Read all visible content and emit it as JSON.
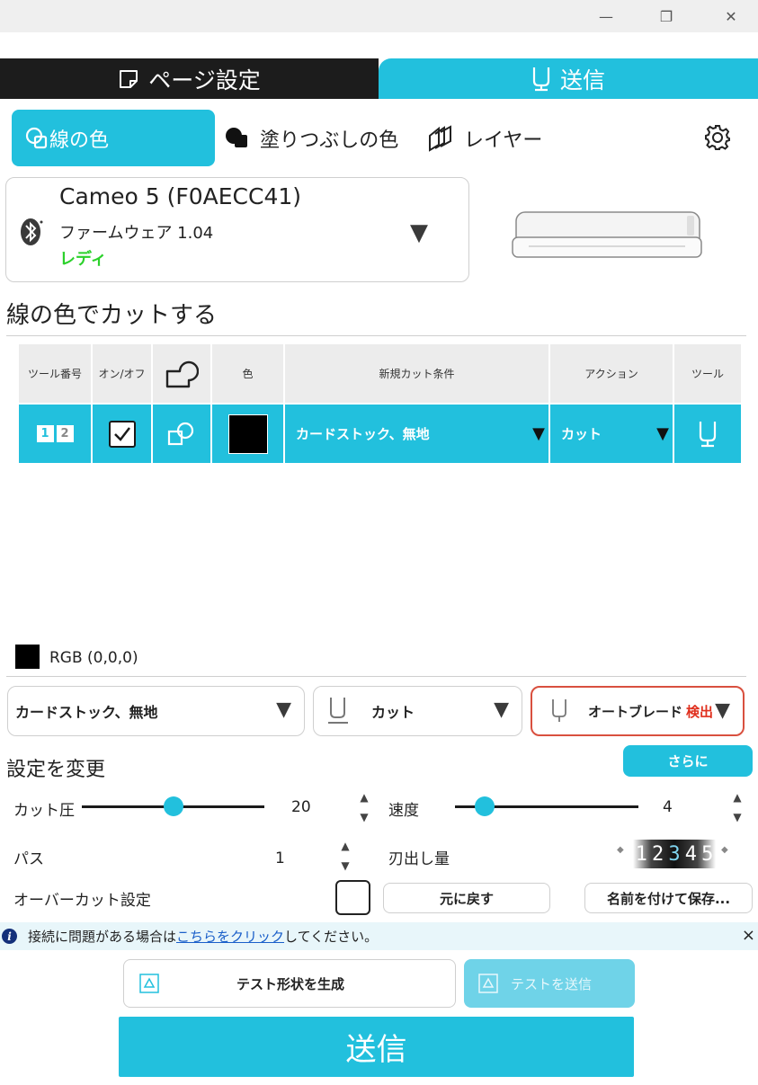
{
  "window": {
    "minimize_glyph": "—",
    "restore_glyph": "❐",
    "close_glyph": "✕"
  },
  "main_tabs": [
    {
      "label": "ページ設定",
      "icon": "page-icon",
      "active": false
    },
    {
      "label": "送信",
      "icon": "blade-holder-icon",
      "active": true
    }
  ],
  "sub_tabs": [
    {
      "label": "線の色",
      "icon": "line-color-icon",
      "active": true
    },
    {
      "label": "塗りつぶしの色",
      "icon": "fill-color-icon",
      "active": false
    },
    {
      "label": "レイヤー",
      "icon": "layer-icon",
      "active": false
    }
  ],
  "settings_icon": "gear-icon",
  "device": {
    "name": "Cameo 5 (F0AECC41)",
    "firmware": "ファームウェア 1.04",
    "status": "レディ",
    "status_color": "#2bd12b",
    "connection_icon": "bluetooth-icon"
  },
  "section_title": "線の色でカットする",
  "table": {
    "headers": [
      "ツール番号",
      "オン/オフ",
      "",
      "色",
      "新規カット条件",
      "アクション",
      "ツール"
    ],
    "rows": [
      {
        "tool_numbers": [
          "1",
          "2"
        ],
        "enabled": true,
        "color": "#000000",
        "material": "カードストック、無地",
        "action": "カット"
      }
    ]
  },
  "selected_color": {
    "swatch": "#000000",
    "label": "RGB (0,0,0)"
  },
  "dropdowns": {
    "material": "カードストック、無地",
    "action": "カット",
    "blade": "オートブレード",
    "blade_detected": "検出",
    "blade_detected_color": "#e0301e"
  },
  "settings": {
    "title": "設定を変更",
    "more_label": "さらに",
    "force_label": "カット圧",
    "force_value": "20",
    "force_fraction": 0.5,
    "speed_label": "速度",
    "speed_value": "4",
    "speed_fraction": 0.16,
    "passes_label": "パス",
    "passes_value": "1",
    "blade_depth_label": "刃出し量",
    "blade_depth_digits": [
      "1",
      "2",
      "3",
      "4",
      "5"
    ],
    "overcut_label": "オーバーカット設定",
    "overcut_checked": false,
    "revert_label": "元に戻す",
    "save_label": "名前を付けて保存..."
  },
  "info_bar": {
    "prefix": "接続に問題がある場合は",
    "link": "こちらをクリック",
    "suffix": "してください。",
    "close_glyph": "×"
  },
  "test_buttons": {
    "generate_label": "テスト形状を生成",
    "send_test_label": "テストを送信"
  },
  "send_label": "送信",
  "accent_color": "#22c0dd"
}
